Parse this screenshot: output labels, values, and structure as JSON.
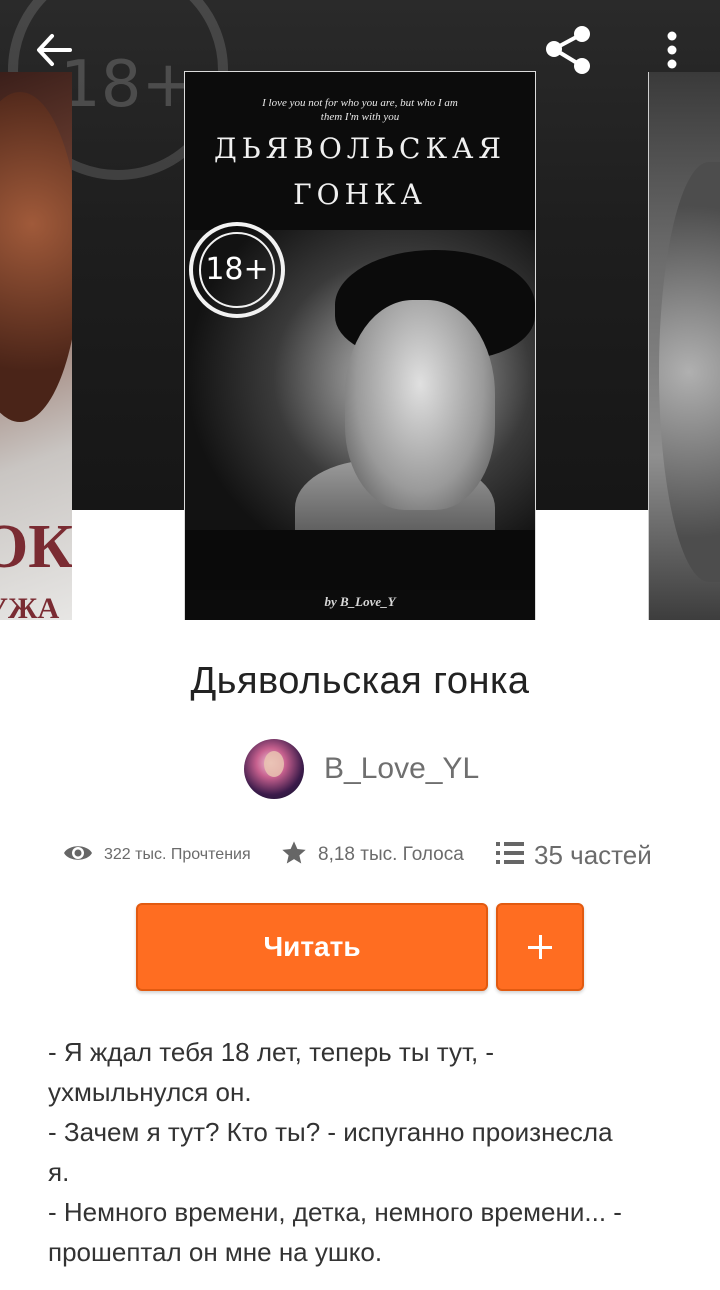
{
  "header": {
    "back_icon": "arrow-left-icon",
    "share_icon": "share-icon",
    "more_icon": "more-vertical-icon"
  },
  "cover": {
    "tagline_line1": "I love you not for who you are, but who I am",
    "tagline_line2": "them I'm with you",
    "title_line1": "ДЬЯВОЛЬСКАЯ",
    "title_line2": "ГОНКА",
    "age_badge": "18+",
    "byline": "by B_Love_Y",
    "background_badge": "18+"
  },
  "side_covers": {
    "left_big_text": "ОК",
    "left_small_text": "УЖА"
  },
  "book": {
    "title": "Дьявольская гонка",
    "author": "B_Love_YL"
  },
  "stats": {
    "reads": "322 тыс. Прочтения",
    "votes": "8,18 тыс. Голоса",
    "parts": "35 частей"
  },
  "actions": {
    "read_label": "Читать",
    "add_icon": "plus-icon",
    "accent_color": "#ff6d21"
  },
  "description": {
    "lines": [
      "- Я ждал тебя 18 лет, теперь ты тут, -",
      "ухмыльнулся он.",
      "- Зачем я тут? Кто ты? - испуганно произнесла",
      "я.",
      "- Немного времени, детка, немного времени... -",
      "прошептал он мне на ушко."
    ]
  }
}
